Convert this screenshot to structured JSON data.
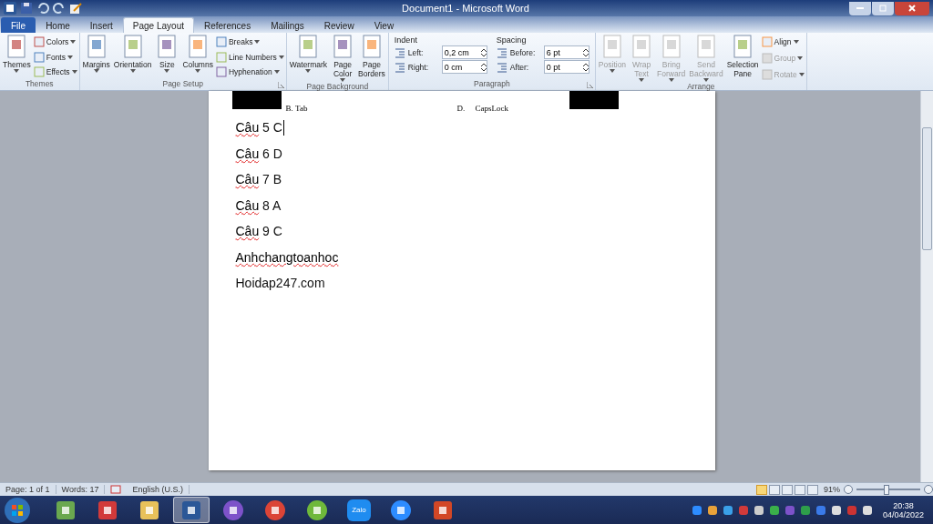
{
  "window": {
    "title": "Document1  -  Microsoft Word"
  },
  "tabs": [
    {
      "label": "File",
      "kind": "file",
      "selected": false
    },
    {
      "label": "Home",
      "kind": "tab",
      "selected": false
    },
    {
      "label": "Insert",
      "kind": "tab",
      "selected": false
    },
    {
      "label": "Page Layout",
      "kind": "tab",
      "selected": true
    },
    {
      "label": "References",
      "kind": "tab",
      "selected": false
    },
    {
      "label": "Mailings",
      "kind": "tab",
      "selected": false
    },
    {
      "label": "Review",
      "kind": "tab",
      "selected": false
    },
    {
      "label": "View",
      "kind": "tab",
      "selected": false
    }
  ],
  "ribbon": {
    "groups": [
      {
        "label": "Themes",
        "launcher": false,
        "items": [
          {
            "kind": "large",
            "lines": [
              "Themes"
            ],
            "dropdown": true,
            "disabled": false
          },
          {
            "kind": "stack",
            "items": [
              {
                "label": "Colors",
                "dropdown": true,
                "disabled": false
              },
              {
                "label": "Fonts",
                "dropdown": true,
                "disabled": false
              },
              {
                "label": "Effects",
                "dropdown": true,
                "disabled": false
              }
            ]
          }
        ]
      },
      {
        "label": "Page Setup",
        "launcher": true,
        "items": [
          {
            "kind": "large",
            "lines": [
              "Margins"
            ],
            "dropdown": true,
            "disabled": false
          },
          {
            "kind": "large",
            "lines": [
              "Orientation"
            ],
            "dropdown": true,
            "disabled": false
          },
          {
            "kind": "large",
            "lines": [
              "Size"
            ],
            "dropdown": true,
            "disabled": false
          },
          {
            "kind": "large",
            "lines": [
              "Columns"
            ],
            "dropdown": true,
            "disabled": false
          },
          {
            "kind": "stack",
            "items": [
              {
                "label": "Breaks",
                "dropdown": true,
                "disabled": false
              },
              {
                "label": "Line Numbers",
                "dropdown": true,
                "disabled": false
              },
              {
                "label": "Hyphenation",
                "dropdown": true,
                "disabled": false
              }
            ]
          }
        ]
      },
      {
        "label": "Page Background",
        "launcher": false,
        "items": [
          {
            "kind": "large",
            "lines": [
              "Watermark"
            ],
            "dropdown": true,
            "disabled": false
          },
          {
            "kind": "large",
            "lines": [
              "Page",
              "Color"
            ],
            "dropdown": true,
            "disabled": false
          },
          {
            "kind": "large",
            "lines": [
              "Page",
              "Borders"
            ],
            "dropdown": false,
            "disabled": false
          }
        ]
      },
      {
        "label": "Paragraph",
        "launcher": true,
        "items": [
          {
            "kind": "fields",
            "title": "Indent",
            "rows": [
              {
                "label": "Left:",
                "value": "0,2 cm"
              },
              {
                "label": "Right:",
                "value": "0 cm"
              }
            ]
          },
          {
            "kind": "fields",
            "title": "Spacing",
            "rows": [
              {
                "label": "Before:",
                "value": "6 pt"
              },
              {
                "label": "After:",
                "value": "0 pt"
              }
            ]
          }
        ]
      },
      {
        "label": "Arrange",
        "launcher": false,
        "items": [
          {
            "kind": "large",
            "lines": [
              "Position"
            ],
            "dropdown": true,
            "disabled": true
          },
          {
            "kind": "large",
            "lines": [
              "Wrap",
              "Text"
            ],
            "dropdown": true,
            "disabled": true
          },
          {
            "kind": "large",
            "lines": [
              "Bring",
              "Forward"
            ],
            "dropdown": true,
            "disabled": true
          },
          {
            "kind": "large",
            "lines": [
              "Send",
              "Backward"
            ],
            "dropdown": true,
            "disabled": true
          },
          {
            "kind": "large",
            "lines": [
              "Selection",
              "Pane"
            ],
            "dropdown": false,
            "disabled": false
          },
          {
            "kind": "stack",
            "items": [
              {
                "label": "Align",
                "dropdown": true,
                "disabled": false
              },
              {
                "label": "Group",
                "dropdown": true,
                "disabled": true
              },
              {
                "label": "Rotate",
                "dropdown": true,
                "disabled": true
              }
            ]
          }
        ]
      }
    ]
  },
  "document": {
    "options": [
      {
        "letter": "B.",
        "text": "Tab"
      },
      {
        "letter": "D.",
        "text": "CapsLock"
      }
    ],
    "lines": [
      {
        "cursor": true,
        "parts": [
          {
            "text": "Câu",
            "misspelled": true
          },
          {
            "text": " 5 C",
            "misspelled": false
          }
        ]
      },
      {
        "cursor": false,
        "parts": [
          {
            "text": "Câu",
            "misspelled": true
          },
          {
            "text": " 6 D",
            "misspelled": false
          }
        ]
      },
      {
        "cursor": false,
        "parts": [
          {
            "text": "Câu",
            "misspelled": true
          },
          {
            "text": " 7 B",
            "misspelled": false
          }
        ]
      },
      {
        "cursor": false,
        "parts": [
          {
            "text": "Câu",
            "misspelled": true
          },
          {
            "text": " 8 A",
            "misspelled": false
          }
        ]
      },
      {
        "cursor": false,
        "parts": [
          {
            "text": "Câu",
            "misspelled": true
          },
          {
            "text": " 9 C",
            "misspelled": false
          }
        ]
      },
      {
        "cursor": false,
        "parts": [
          {
            "text": "Anhchangtoanhoc",
            "misspelled": true
          }
        ]
      },
      {
        "cursor": false,
        "parts": [
          {
            "text": "Hoidap247.com",
            "misspelled": false
          }
        ]
      }
    ]
  },
  "status_bar": {
    "page": "Page: 1 of 1",
    "words": "Words: 17",
    "language": "English (U.S.)",
    "views": [
      {
        "selected": true
      },
      {
        "selected": false
      },
      {
        "selected": false
      },
      {
        "selected": false
      },
      {
        "selected": false
      }
    ],
    "zoom": "91%",
    "zoom_slider": {
      "level": 0.47
    }
  },
  "taskbar": {
    "items": [
      {
        "kind": "files",
        "selected": false
      },
      {
        "kind": "pdf",
        "selected": false
      },
      {
        "kind": "folder",
        "selected": false
      },
      {
        "kind": "word",
        "selected": true
      },
      {
        "kind": "viber",
        "selected": false
      },
      {
        "kind": "chrome",
        "selected": false
      },
      {
        "kind": "coccoc",
        "selected": false
      },
      {
        "kind": "zalo",
        "label": "Zalo",
        "selected": false
      },
      {
        "kind": "zoom",
        "selected": false
      },
      {
        "kind": "powerpoint",
        "selected": false
      }
    ],
    "time": "20:38",
    "date": "04/04/2022"
  }
}
